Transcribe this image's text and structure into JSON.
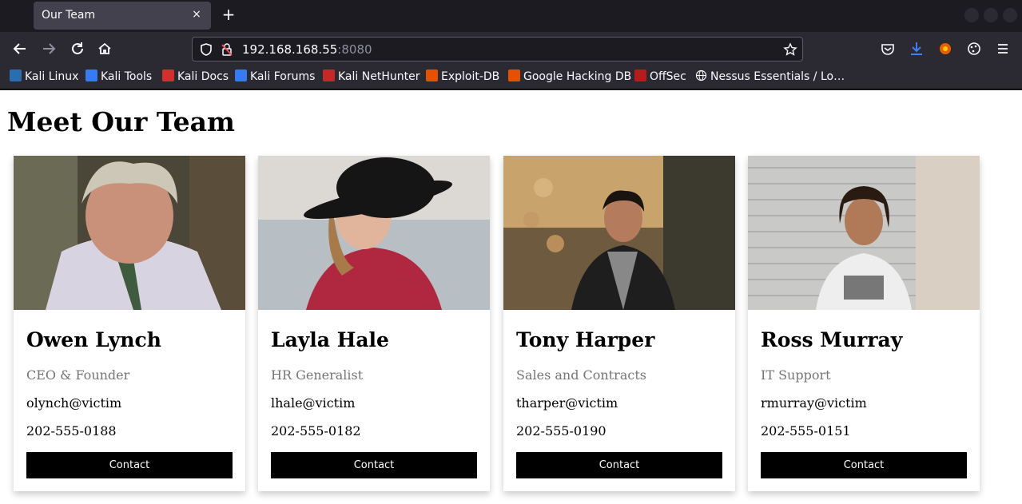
{
  "browser": {
    "tab_title": "Our Team",
    "tab_close": "×",
    "new_tab": "+",
    "url_host": "192.168.168.55",
    "url_port": ":8080",
    "bookmarks": [
      {
        "label": "Kali Linux",
        "color": "#2a6db0"
      },
      {
        "label": "Kali Tools",
        "color": "#367bf0"
      },
      {
        "label": "Kali Docs",
        "color": "#d32f2f"
      },
      {
        "label": "Kali Forums",
        "color": "#367bf0"
      },
      {
        "label": "Kali NetHunter",
        "color": "#c62828"
      },
      {
        "label": "Exploit-DB",
        "color": "#e65100"
      },
      {
        "label": "Google Hacking DB",
        "color": "#e65100"
      },
      {
        "label": "OffSec",
        "color": "#b71c1c"
      },
      {
        "label": "Nessus Essentials / Lo…",
        "color": "#ffffff"
      }
    ]
  },
  "page": {
    "title": "Meet Our Team",
    "team": [
      {
        "name": "Owen Lynch",
        "role": "CEO & Founder",
        "email": "olynch@victim",
        "phone": "202-555-0188",
        "button": "Contact"
      },
      {
        "name": "Layla Hale",
        "role": "HR Generalist",
        "email": "lhale@victim",
        "phone": "202-555-0182",
        "button": "Contact"
      },
      {
        "name": "Tony Harper",
        "role": "Sales and Contracts",
        "email": "tharper@victim",
        "phone": "202-555-0190",
        "button": "Contact"
      },
      {
        "name": "Ross Murray",
        "role": "IT Support",
        "email": "rmurray@victim",
        "phone": "202-555-0151",
        "button": "Contact"
      }
    ]
  }
}
